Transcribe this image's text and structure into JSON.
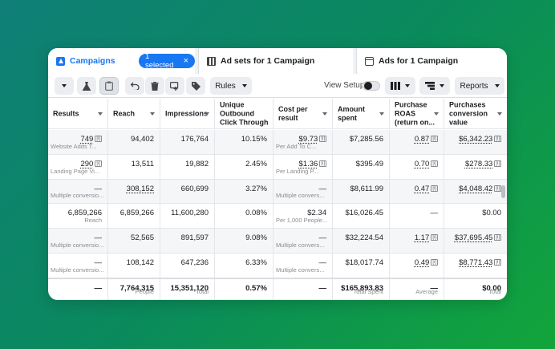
{
  "tabs": {
    "campaigns": "Campaigns",
    "selected_badge": "1 selected",
    "adsets": "Ad sets for 1 Campaign",
    "ads": "Ads for 1 Campaign"
  },
  "toolbar": {
    "rules_label": "Rules",
    "view_setup_label": "View Setup",
    "reports_label": "Reports",
    "icons": [
      "chevron-down-icon",
      "flask-icon",
      "clipboard-icon",
      "undo-icon",
      "trash-icon",
      "duplicate-icon",
      "tag-icon",
      "columns-icon",
      "breakdown-icon"
    ]
  },
  "columns": [
    "Results",
    "Reach",
    "Impressions",
    "Unique Outbound Click Through",
    "Cost per result",
    "Amount spent",
    "Purchase ROAS (return on...",
    "Purchases conversion value"
  ],
  "rows": [
    {
      "results": "749",
      "results_sub": "Website Adds T...",
      "reach": "94,402",
      "impressions": "176,764",
      "ctr": "10.15%",
      "cpr": "$9.73",
      "cpr_sub": "Per Add To C...",
      "spent": "$7,285.56",
      "roas": "0.87",
      "conv": "$6,342.23"
    },
    {
      "results": "290",
      "results_sub": "Landing Page Vi...",
      "reach": "13,511",
      "impressions": "19,882",
      "ctr": "2.45%",
      "cpr": "$1.36",
      "cpr_sub": "Per Landing P...",
      "spent": "$395.49",
      "roas": "0.70",
      "conv": "$278.33"
    },
    {
      "results": "—",
      "results_sub": "Multiple conversio...",
      "reach": "308,152",
      "impressions": "660,699",
      "ctr": "3.27%",
      "cpr": "—",
      "cpr_sub": "Multiple convers...",
      "spent": "$8,611.99",
      "roas": "0.47",
      "conv": "$4,048.42"
    },
    {
      "results": "6,859,266",
      "results_sub": "Reach",
      "reach": "6,859,266",
      "impressions": "11,600,280",
      "ctr": "0.08%",
      "cpr": "$2.34",
      "cpr_sub": "Per 1,000 People...",
      "spent": "$16,026.45",
      "roas": "—",
      "conv": "$0.00"
    },
    {
      "results": "—",
      "results_sub": "Multiple conversio...",
      "reach": "52,565",
      "impressions": "891,597",
      "ctr": "9.08%",
      "cpr": "—",
      "cpr_sub": "Multiple convers...",
      "spent": "$32,224.54",
      "roas": "1.17",
      "conv": "$37,695.45"
    },
    {
      "results": "—",
      "results_sub": "Multiple conversio...",
      "reach": "108,142",
      "impressions": "647,236",
      "ctr": "6.33%",
      "cpr": "—",
      "cpr_sub": "Multiple convers...",
      "spent": "$18,017.74",
      "roas": "0.49",
      "conv": "$8,771.43"
    }
  ],
  "totals": {
    "results": "—",
    "reach": "7,764,315",
    "reach_sub": "People",
    "impressions": "15,351,120",
    "impressions_sub": "Total",
    "ctr": "0.57%",
    "cpr": "—",
    "spent": "$165,893.83",
    "spent_sub": "Total Spent",
    "roas": "—",
    "roas_sub": "Average",
    "conv": "$0.00",
    "conv_sub": "Total"
  },
  "info_marker": "[i]"
}
